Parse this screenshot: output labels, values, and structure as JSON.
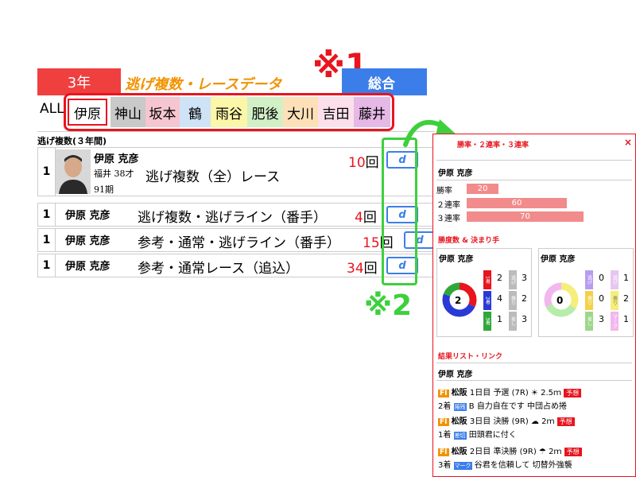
{
  "header": {
    "year_tab": "3年",
    "title": "逃げ複数・レースデータ",
    "overall_tab": "総合",
    "note1": "※1",
    "note2": "※2"
  },
  "racers_nav": {
    "all_label": "ALL",
    "items": [
      {
        "label": "伊原",
        "bg": "#ffffff",
        "selected": true
      },
      {
        "label": "神山",
        "bg": "#c9c9c9"
      },
      {
        "label": "坂本",
        "bg": "#f6c6d0"
      },
      {
        "label": "鶴",
        "bg": "#cfe3f6"
      },
      {
        "label": "雨谷",
        "bg": "#fbf6a8"
      },
      {
        "label": "肥後",
        "bg": "#d2f0c6"
      },
      {
        "label": "大川",
        "bg": "#fde0b8"
      },
      {
        "label": "吉田",
        "bg": "#fbe0ec"
      },
      {
        "label": "藤井",
        "bg": "#e6b8e6"
      }
    ]
  },
  "section_label": "逃げ複数(３年間)",
  "rows": [
    {
      "rank": "1",
      "name": "伊原 克彦",
      "meta1": "福井 38才",
      "meta2": "91期",
      "desc": "逃げ複数（全）レース",
      "count": "10",
      "unit": "回",
      "btn": "d"
    },
    {
      "rank": "1",
      "name": "伊原 克彦",
      "desc": "逃げ複数・逃げライン（番手）",
      "count": "4",
      "unit": "回",
      "btn": "d"
    },
    {
      "rank": "1",
      "name": "伊原 克彦",
      "desc": "参考・通常・逃げライン（番手）",
      "count": "15",
      "unit": "回",
      "btn": "d"
    },
    {
      "rank": "1",
      "name": "伊原 克彦",
      "desc": "参考・通常レース（追込）",
      "count": "34",
      "unit": "回",
      "btn": "d"
    }
  ],
  "panel": {
    "header": "勝率・２連率・３連率",
    "close": "×",
    "racer_name": "伊原 克彦",
    "rates": [
      {
        "label": "勝率",
        "value": "20"
      },
      {
        "label": "２連率",
        "value": "60"
      },
      {
        "label": "３連率",
        "value": "70"
      }
    ],
    "kimarite_title": "勝度数 & 決まり手",
    "left_box": {
      "name": "伊原 克彦",
      "center": "2",
      "counts": [
        "2",
        "4",
        "1"
      ],
      "sub_counts": [
        "3",
        "2",
        "3"
      ],
      "labels": [
        "1着",
        "2着",
        "3着"
      ],
      "kinds": [
        "逃げ",
        "捲り",
        "差し"
      ]
    },
    "right_box": {
      "name": "伊原 克彦",
      "center": "0",
      "counts": [
        "0",
        "0",
        "3"
      ],
      "sub_counts": [
        "1",
        "2",
        "1"
      ],
      "labels": [
        "逃げ",
        "捲り",
        "差し"
      ],
      "kinds": [
        "逃げ",
        "捲り",
        "マーク"
      ]
    },
    "results_title": "結果リスト・リンク",
    "results_name": "伊原 克彦",
    "results": [
      {
        "grade": "FI",
        "venue": "松阪",
        "day": "1日目",
        "race": "予選 (7R)",
        "weather": "☀",
        "dist": "2.5ｍ",
        "badge": "予想",
        "pos": "2着",
        "kind": "捲残",
        "kind2": "B",
        "comment": "自力自在です",
        "comment2": "中団占め捲"
      },
      {
        "grade": "FI",
        "venue": "松阪",
        "day": "3日目",
        "race": "決勝 (9R)",
        "weather": "☁",
        "dist": "2ｍ",
        "badge": "予想",
        "pos": "1着",
        "kind": "差切",
        "comment": "田頭君に付く"
      },
      {
        "grade": "FI",
        "venue": "松阪",
        "day": "2日目",
        "race": "準決勝 (9R)",
        "weather": "☂",
        "dist": "2ｍ",
        "badge": "予想",
        "pos": "3着",
        "kind": "マーク",
        "comment": "谷君を信頼して",
        "comment2": "切替外強襲"
      }
    ]
  },
  "colors": {
    "red": "#e8141e",
    "blue": "#3c7ee9",
    "green": "#3dd03d",
    "orange": "#f29200"
  }
}
